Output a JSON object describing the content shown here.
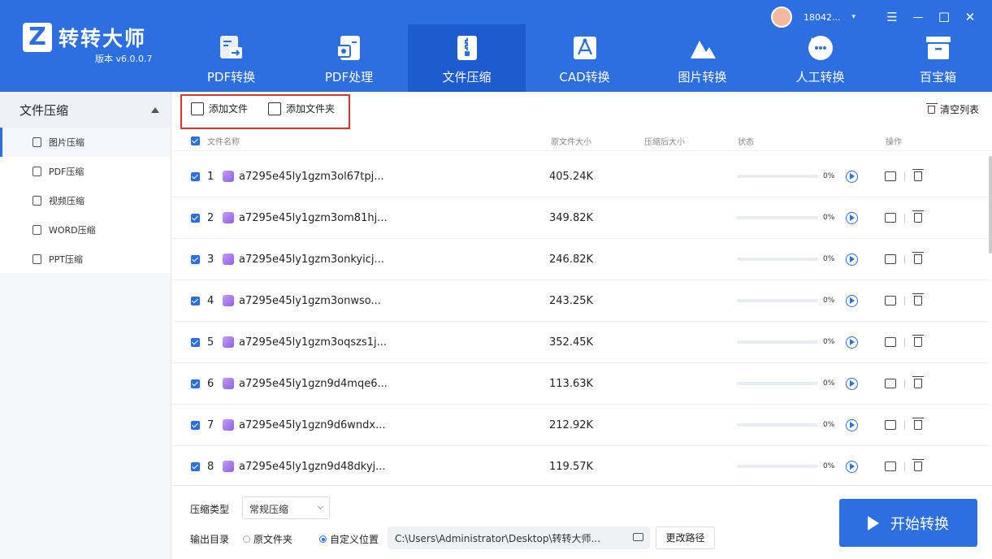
{
  "app": {
    "title": "转转大师",
    "version": "版本 v6.0.0.7",
    "logo_letter": "Z"
  },
  "account": {
    "username": "18042...",
    "dropdown_glyph": "▾"
  },
  "window_controls": {
    "menu": "☰",
    "minimize": "—",
    "maximize": "☐",
    "close": "✕"
  },
  "nav": {
    "items": [
      {
        "label": "PDF转换"
      },
      {
        "label": "PDF处理"
      },
      {
        "label": "文件压缩"
      },
      {
        "label": "CAD转换"
      },
      {
        "label": "图片转换"
      },
      {
        "label": "人工转换"
      },
      {
        "label": "百宝箱"
      }
    ]
  },
  "sidebar": {
    "header": "文件压缩",
    "items": [
      {
        "label": "图片压缩"
      },
      {
        "label": "PDF压缩"
      },
      {
        "label": "视频压缩"
      },
      {
        "label": "WORD压缩"
      },
      {
        "label": "PPT压缩"
      }
    ]
  },
  "toolbar": {
    "add_file": "添加文件",
    "add_folder": "添加文件夹",
    "clear_list": "清空列表"
  },
  "table": {
    "headers": {
      "name": "文件名称",
      "original_size": "原文件大小",
      "compressed_size": "压缩后大小",
      "status": "状态",
      "actions": "操作"
    },
    "rows": [
      {
        "index": "1",
        "name": "a7295e45ly1gzm3ol67tpj...",
        "size": "405.24K",
        "progress": "0%"
      },
      {
        "index": "2",
        "name": "a7295e45ly1gzm3om81hj...",
        "size": "349.82K",
        "progress": "0%"
      },
      {
        "index": "3",
        "name": "a7295e45ly1gzm3onkyicj...",
        "size": "246.82K",
        "progress": "0%"
      },
      {
        "index": "4",
        "name": "a7295e45ly1gzm3onwso...",
        "size": "243.25K",
        "progress": "0%"
      },
      {
        "index": "5",
        "name": "a7295e45ly1gzm3oqszs1j...",
        "size": "352.45K",
        "progress": "0%"
      },
      {
        "index": "6",
        "name": "a7295e45ly1gzn9d4mqe6...",
        "size": "113.63K",
        "progress": "0%"
      },
      {
        "index": "7",
        "name": "a7295e45ly1gzn9d6wndx...",
        "size": "212.92K",
        "progress": "0%"
      },
      {
        "index": "8",
        "name": "a7295e45ly1gzn9d48dkyj...",
        "size": "119.57K",
        "progress": "0%"
      }
    ]
  },
  "bottom": {
    "compress_type_label": "压缩类型",
    "compress_type_value": "常规压缩",
    "output_label": "输出目录",
    "option_original": "原文件夹",
    "option_custom": "自定义位置",
    "path": "C:\\Users\\Administrator\\Desktop\\转转大师...",
    "change_path": "更改路径",
    "start": "开始转换"
  },
  "colors": {
    "brand": "#2d6fe0",
    "highlight": "#e5332a"
  }
}
